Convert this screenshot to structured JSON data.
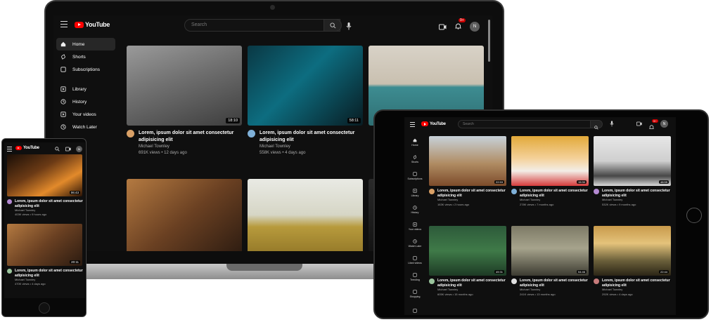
{
  "brand": {
    "logo_text": "YouTube",
    "accent": "#ff0000"
  },
  "laptop": {
    "search_placeholder": "Search",
    "notifications_badge": "9+",
    "avatar_initial": "N",
    "sidebar": [
      {
        "label": "Home",
        "icon": "home-icon",
        "active": true
      },
      {
        "label": "Shorts",
        "icon": "shorts-icon"
      },
      {
        "label": "Subscriptions",
        "icon": "subscriptions-icon"
      },
      {
        "label": "Library",
        "icon": "library-icon",
        "gap": true
      },
      {
        "label": "History",
        "icon": "history-icon"
      },
      {
        "label": "Your videos",
        "icon": "your-videos-icon"
      },
      {
        "label": "Watch Later",
        "icon": "watch-later-icon"
      }
    ],
    "videos": [
      {
        "title": "Lorem, ipsum dolor sit amet consectetur adipisicing elit",
        "channel": "Michael Townley",
        "meta": "691K views • 12 days ago",
        "duration": "18:10",
        "thumb": "bridge"
      },
      {
        "title": "Lorem, ipsum dolor sit amet consectetur adipisicing elit",
        "channel": "Michael Townley",
        "meta": "558K views • 4 days ago",
        "duration": "58:11",
        "thumb": "phone"
      },
      {
        "title": "",
        "channel": "",
        "meta": "",
        "duration": "",
        "thumb": "pier"
      },
      {
        "title": "",
        "channel": "",
        "meta": "",
        "duration": "",
        "thumb": "laptop"
      },
      {
        "title": "",
        "channel": "",
        "meta": "",
        "duration": "",
        "thumb": "field"
      },
      {
        "title": "",
        "channel": "",
        "meta": "",
        "duration": "",
        "thumb": "dark"
      }
    ]
  },
  "phone": {
    "videos": [
      {
        "title": "Lorem, ipsum dolor sit amet consectetur adipisicing elit",
        "channel": "Michael Townley",
        "meta": "403K views • 9 hours ago",
        "duration": "06:43",
        "thumb": "fire"
      },
      {
        "title": "Lorem, ipsum dolor sit amet consectetur adipisicing elit",
        "channel": "Michael Townley",
        "meta": "470K views • 4 days ago",
        "duration": "20:11",
        "thumb": "laptop"
      }
    ]
  },
  "tablet": {
    "search_placeholder": "Search",
    "notifications_badge": "9+",
    "avatar_initial": "N",
    "sidebar": [
      {
        "label": "Home",
        "icon": "home-icon"
      },
      {
        "label": "Shorts",
        "icon": "shorts-icon"
      },
      {
        "label": "Subscriptions",
        "icon": "subscriptions-icon"
      },
      {
        "label": "Library",
        "icon": "library-icon"
      },
      {
        "label": "History",
        "icon": "history-icon"
      },
      {
        "label": "Your videos",
        "icon": "your-videos-icon"
      },
      {
        "label": "Watch Later",
        "icon": "watch-later-icon"
      },
      {
        "label": "Liked videos",
        "icon": "liked-videos-icon"
      },
      {
        "label": "Trending",
        "icon": "trending-icon"
      },
      {
        "label": "Shopping",
        "icon": "shopping-icon"
      },
      {
        "label": "",
        "icon": "music-icon"
      }
    ],
    "videos": [
      {
        "title": "Lorem, ipsum dolor sit amet consectetur adipisicing elit",
        "channel": "Michael Townley",
        "meta": "163K views • 2 hours ago",
        "duration": "22:53",
        "thumb": "cow"
      },
      {
        "title": "Lorem, ipsum dolor sit amet consectetur adipisicing elit",
        "channel": "Michael Townley",
        "meta": "278K views • 7 months ago",
        "duration": "15:30",
        "thumb": "berries"
      },
      {
        "title": "Lorem, ipsum dolor sit amet consectetur adipisicing elit",
        "channel": "Michael Townley",
        "meta": "532K views • 9 months ago",
        "duration": "48:55",
        "thumb": "mountain"
      },
      {
        "title": "Lorem, ipsum dolor sit amet consectetur adipisicing elit",
        "channel": "Michael Townley",
        "meta": "605K views • 15 months ago",
        "duration": "49:31",
        "thumb": "girl"
      },
      {
        "title": "Lorem, ipsum dolor sit amet consectetur adipisicing elit",
        "channel": "Michael Townley",
        "meta": "241K views • 13 months ago",
        "duration": "54:46",
        "thumb": "fog"
      },
      {
        "title": "Lorem, ipsum dolor sit amet consectetur adipisicing elit",
        "channel": "Michael Townley",
        "meta": "292K views • 4 days ago",
        "duration": "22:44",
        "thumb": "sunset"
      }
    ]
  }
}
